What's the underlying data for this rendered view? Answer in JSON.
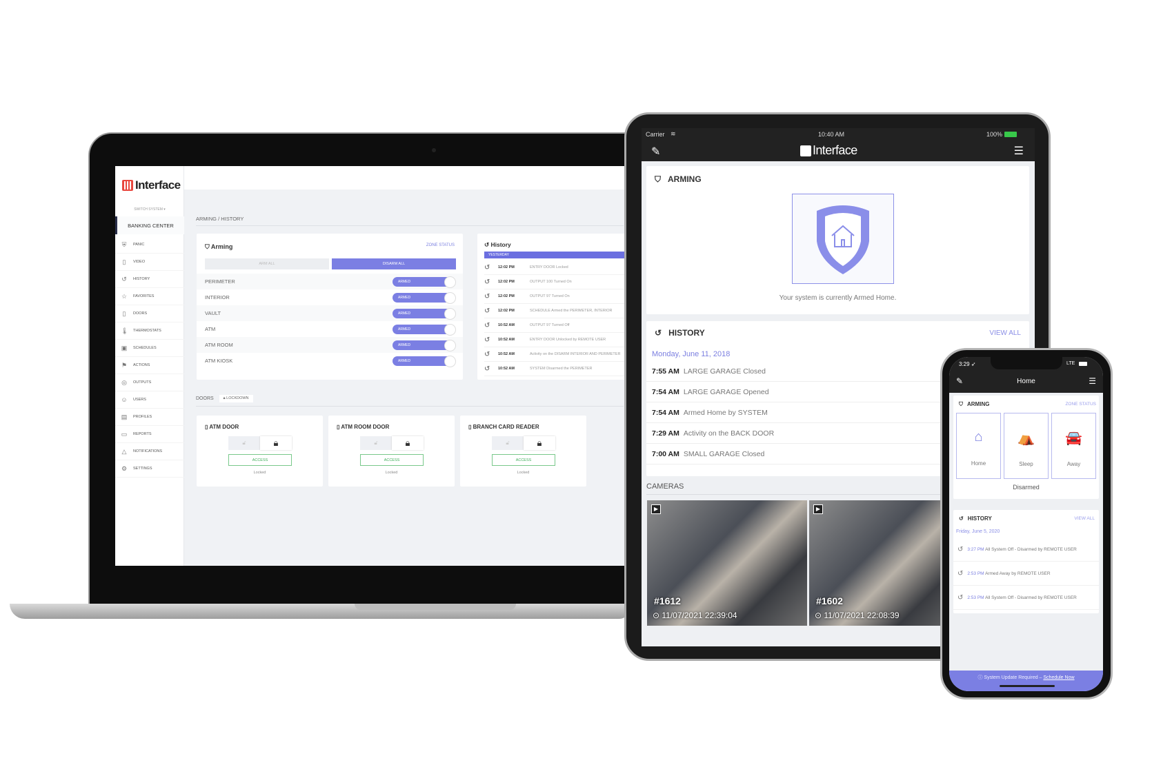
{
  "laptop": {
    "logo": "Interface",
    "switch_system": "SWITCH SYSTEM ▾",
    "current_system": "BANKING CENTER",
    "nav": [
      {
        "icon": "panic-icon",
        "glyph": "⛨",
        "label": "PANIC"
      },
      {
        "icon": "video-icon",
        "glyph": "▯",
        "label": "VIDEO"
      },
      {
        "icon": "history-icon",
        "glyph": "↺",
        "label": "HISTORY"
      },
      {
        "icon": "star-icon",
        "glyph": "☆",
        "label": "FAVORITES"
      },
      {
        "icon": "door-icon",
        "glyph": "▯",
        "label": "DOORS"
      },
      {
        "icon": "thermometer-icon",
        "glyph": "🌡",
        "label": "THERMOSTATS"
      },
      {
        "icon": "calendar-icon",
        "glyph": "▣",
        "label": "SCHEDULES"
      },
      {
        "icon": "actions-icon",
        "glyph": "⚑",
        "label": "ACTIONS"
      },
      {
        "icon": "outputs-icon",
        "glyph": "◎",
        "label": "OUTPUTS"
      },
      {
        "icon": "users-icon",
        "glyph": "☺",
        "label": "USERS"
      },
      {
        "icon": "profiles-icon",
        "glyph": "▤",
        "label": "PROFILES"
      },
      {
        "icon": "folder-icon",
        "glyph": "▭",
        "label": "REPORTS"
      },
      {
        "icon": "bell-icon",
        "glyph": "△",
        "label": "NOTIFICATIONS"
      },
      {
        "icon": "gear-icon",
        "glyph": "⚙",
        "label": "SETTINGS"
      }
    ],
    "breadcrumb": "ARMING / HISTORY",
    "arming": {
      "title": "Arming",
      "zone_status": "ZONE STATUS",
      "arm_all": "ARM ALL",
      "disarm_all": "DISARM ALL",
      "zones": [
        {
          "name": "PERIMETER",
          "state": "ARMED"
        },
        {
          "name": "INTERIOR",
          "state": "ARMED"
        },
        {
          "name": "VAULT",
          "state": "ARMED"
        },
        {
          "name": "ATM",
          "state": "ARMED"
        },
        {
          "name": "ATM ROOM",
          "state": "ARMED"
        },
        {
          "name": "ATM KIOSK",
          "state": "ARMED"
        }
      ]
    },
    "history": {
      "title": "History",
      "group": "YESTERDAY",
      "rows": [
        {
          "time": "12:02 PM",
          "text": "ENTRY DOOR Locked"
        },
        {
          "time": "12:02 PM",
          "text": "OUTPUT 100 Turned On"
        },
        {
          "time": "12:02 PM",
          "text": "OUTPUT 97 Turned On"
        },
        {
          "time": "12:02 PM",
          "text": "SCHEDULE Armed the PERIMETER, INTERIOR"
        },
        {
          "time": "10:52 AM",
          "text": "OUTPUT 97 Turned Off"
        },
        {
          "time": "10:52 AM",
          "text": "ENTRY DOOR Unlocked by REMOTE USER"
        },
        {
          "time": "10:52 AM",
          "text": "Activity on the DISARM INTERIOR AND PERIMETER"
        },
        {
          "time": "10:52 AM",
          "text": "SYSTEM Disarmed the PERIMETER"
        }
      ]
    },
    "doors": {
      "label": "DOORS",
      "lockdown": "LOCKDOWN",
      "cards": [
        {
          "name": "ATM DOOR",
          "access": "ACCESS",
          "status": "Locked"
        },
        {
          "name": "ATM ROOM DOOR",
          "access": "ACCESS",
          "status": "Locked"
        },
        {
          "name": "BRANCH CARD READER",
          "access": "ACCESS",
          "status": "Locked"
        }
      ]
    }
  },
  "tablet": {
    "carrier": "Carrier",
    "time": "10:40 AM",
    "battery": "100%",
    "logo": "Interface",
    "arming": {
      "title": "ARMING",
      "message": "Your system is currently Armed Home."
    },
    "history": {
      "title": "HISTORY",
      "view_all": "VIEW ALL",
      "date": "Monday, June 11, 2018",
      "rows": [
        {
          "time": "7:55 AM",
          "text": "LARGE GARAGE Closed"
        },
        {
          "time": "7:54 AM",
          "text": "LARGE GARAGE Opened"
        },
        {
          "time": "7:54 AM",
          "text": "Armed Home by SYSTEM"
        },
        {
          "time": "7:29 AM",
          "text": "Activity on the BACK DOOR"
        },
        {
          "time": "7:00 AM",
          "text": "SMALL GARAGE Closed"
        }
      ]
    },
    "cameras": {
      "title": "CAMERAS",
      "items": [
        {
          "id": "#1612",
          "timestamp": "⊙ 11/07/2021 22:39:04"
        },
        {
          "id": "#1602",
          "timestamp": "⊙ 11/07/2021 22:08:39"
        }
      ]
    }
  },
  "phone": {
    "time": "3:29 ➶",
    "signal": "LTE",
    "title": "Home",
    "arming": {
      "title": "ARMING",
      "zone_status": "ZONE STATUS",
      "modes": [
        {
          "label": "Home",
          "glyph": "⌂"
        },
        {
          "label": "Sleep",
          "glyph": "⛺"
        },
        {
          "label": "Away",
          "glyph": "🚘"
        }
      ],
      "state": "Disarmed"
    },
    "history": {
      "title": "HISTORY",
      "view_all": "VIEW ALL",
      "date": "Friday, June 5, 2020",
      "rows": [
        {
          "time": "3:27 PM",
          "text": "All System Off - Disarmed by REMOTE USER"
        },
        {
          "time": "2:53 PM",
          "text": "Armed Away by REMOTE USER"
        },
        {
          "time": "2:53 PM",
          "text": "All System Off - Disarmed by REMOTE USER"
        }
      ]
    },
    "update_banner": "ⓘ System Update Required – ",
    "update_link": "Schedule Now"
  },
  "colors": {
    "accent": "#7b7fe3",
    "brand_red": "#e8473e",
    "access_green": "#3fae5a"
  }
}
